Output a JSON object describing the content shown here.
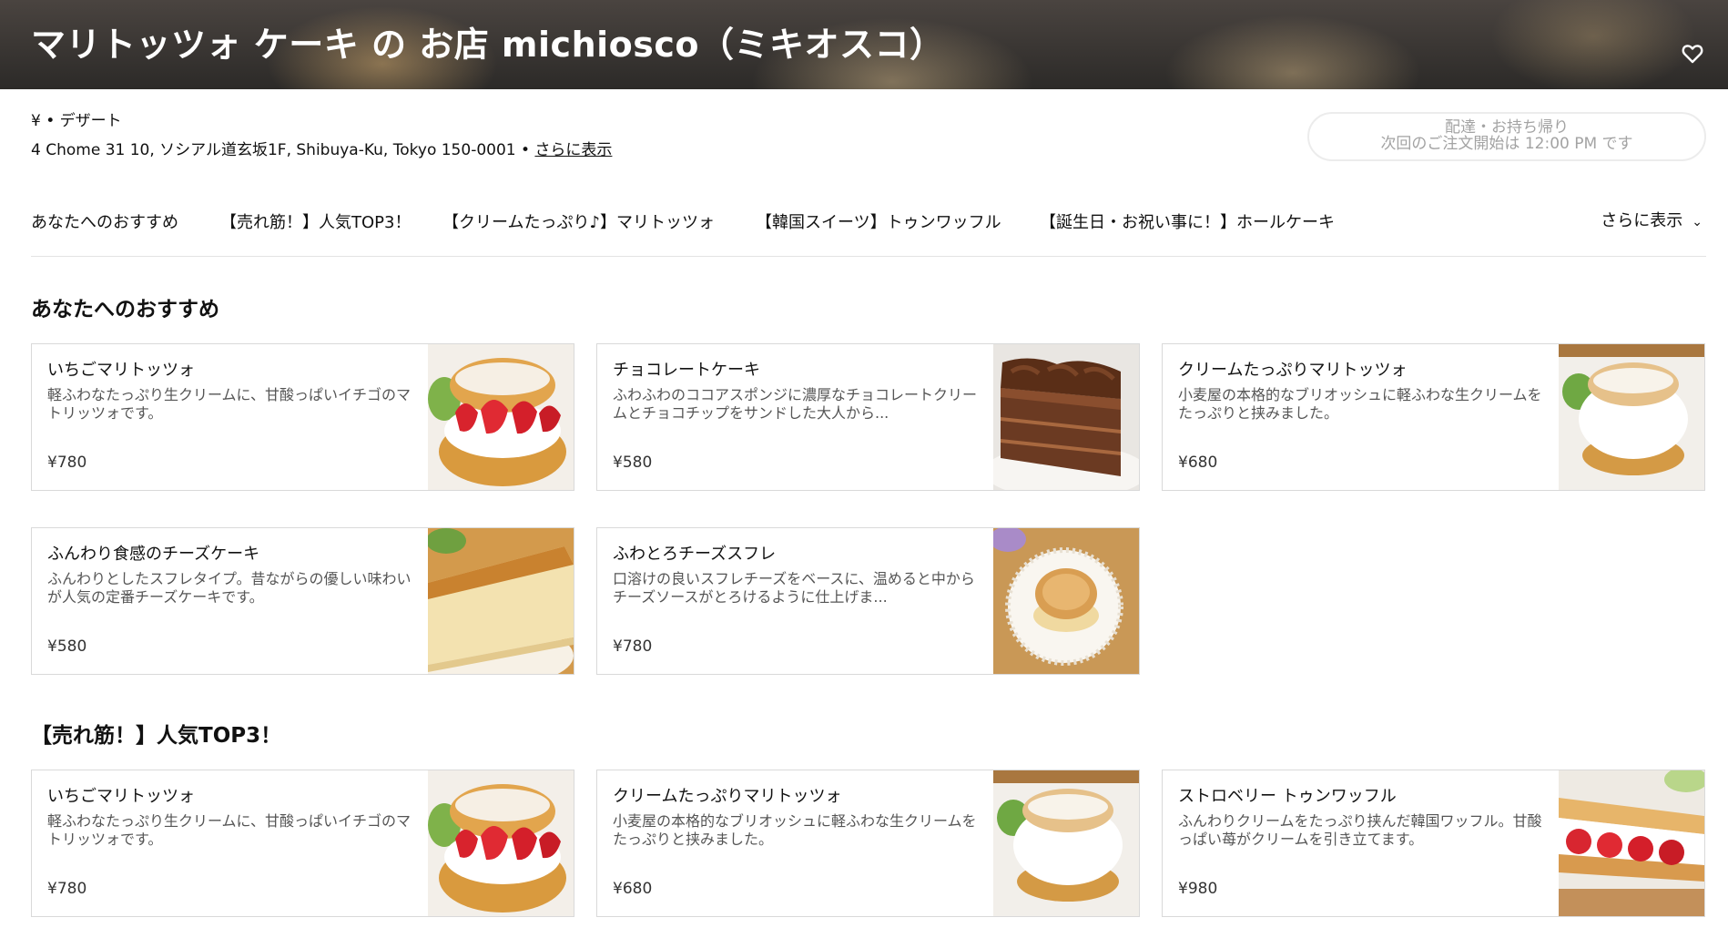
{
  "store": {
    "title": "マリトッツォ ケーキ の お店 michiosco（ミキオスコ）",
    "meta": "¥ • デザート",
    "address": "4 Chome 31 10, ソシアル道玄坂1F, Shibuya-Ku, Tokyo 150-0001 • ",
    "address_more": "さらに表示",
    "favorite_icon": "heart-icon"
  },
  "delivery": {
    "mode": "配達・お持ち帰り",
    "next_order": "次回のご注文開始は 12:00 PM です"
  },
  "nav": {
    "items": [
      "あなたへのおすすめ",
      "【売れ筋！】人気TOP3！",
      "【クリームたっぷり♪】マリトッツォ",
      "【韓国スイーツ】トゥンワッフル",
      "【誕生日・お祝い事に！】ホールケーキ"
    ],
    "more": "さらに表示"
  },
  "sections": [
    {
      "title": "あなたへのおすすめ",
      "items": [
        {
          "name": "いちごマリトッツォ",
          "desc": "軽ふわなたっぷり生クリームに、甘酸っぱいイチゴのマトリッツォです。",
          "price": "¥780",
          "image": "strawberry-maritozzo"
        },
        {
          "name": "チョコレートケーキ",
          "desc": "ふわふわのココアスポンジに濃厚なチョコレートクリームとチョコチップをサンドした大人から...",
          "price": "¥580",
          "image": "chocolate-cake"
        },
        {
          "name": "クリームたっぷりマリトッツォ",
          "desc": "小麦屋の本格的なブリオッシュに軽ふわな生クリームをたっぷりと挟みました。",
          "price": "¥680",
          "image": "cream-maritozzo"
        },
        {
          "name": "ふんわり食感のチーズケーキ",
          "desc": "ふんわりとしたスフレタイプ。昔ながらの優しい味わいが人気の定番チーズケーキです。",
          "price": "¥580",
          "image": "cheesecake"
        },
        {
          "name": "ふわとろチーズスフレ",
          "desc": "口溶けの良いスフレチーズをベースに、温めると中からチーズソースがとろけるように仕上げま...",
          "price": "¥780",
          "image": "cheese-souffle"
        }
      ]
    },
    {
      "title": "【売れ筋！】人気TOP3！",
      "items": [
        {
          "name": "いちごマリトッツォ",
          "desc": "軽ふわなたっぷり生クリームに、甘酸っぱいイチゴのマトリッツォです。",
          "price": "¥780",
          "image": "strawberry-maritozzo"
        },
        {
          "name": "クリームたっぷりマリトッツォ",
          "desc": "小麦屋の本格的なブリオッシュに軽ふわな生クリームをたっぷりと挟みました。",
          "price": "¥680",
          "image": "cream-maritozzo"
        },
        {
          "name": "ストロベリー トゥンワッフル",
          "desc": "ふんわりクリームをたっぷり挟んだ韓国ワッフル。甘酸っぱい苺がクリームを引き立てます。",
          "price": "¥980",
          "image": "strawberry-waffle"
        }
      ]
    }
  ]
}
